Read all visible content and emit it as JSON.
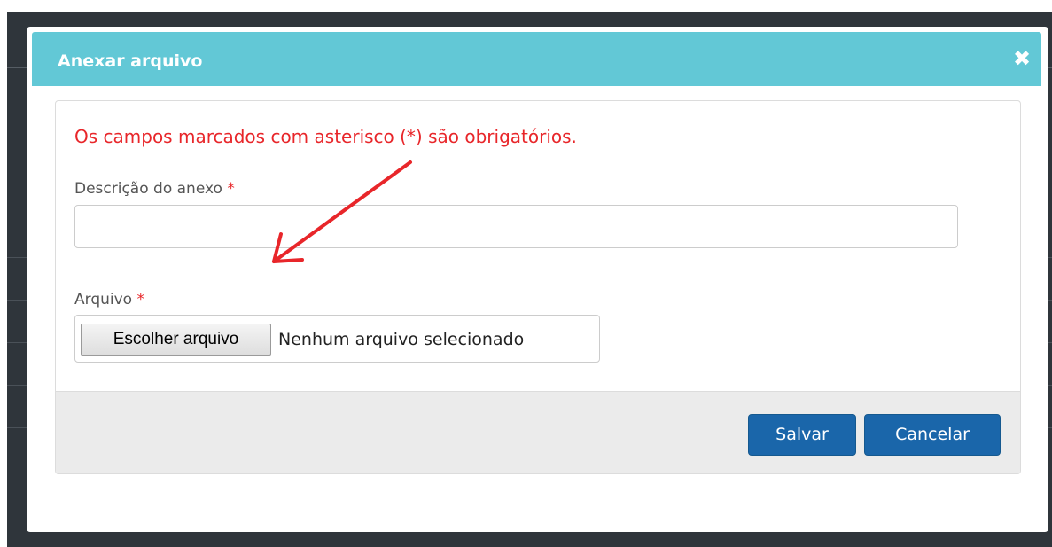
{
  "dialog": {
    "title": "Anexar arquivo",
    "close_icon": "close-x-icon",
    "required_note": "Os campos marcados com asterisco (*) são obrigatórios.",
    "description_field": {
      "label": "Descrição do anexo",
      "required_mark": "*",
      "value": ""
    },
    "file_field": {
      "label": "Arquivo",
      "required_mark": "*",
      "button_label": "Escolher arquivo",
      "status": "Nenhum arquivo selecionado"
    },
    "footer": {
      "save_label": "Salvar",
      "cancel_label": "Cancelar"
    }
  },
  "annotation": {
    "type": "arrow",
    "color": "#e8262a"
  },
  "colors": {
    "header": "#62c8d6",
    "required": "#e8262a",
    "primary_button": "#1a66aa",
    "footer": "#ebebeb",
    "backdrop": "#2f353b"
  }
}
